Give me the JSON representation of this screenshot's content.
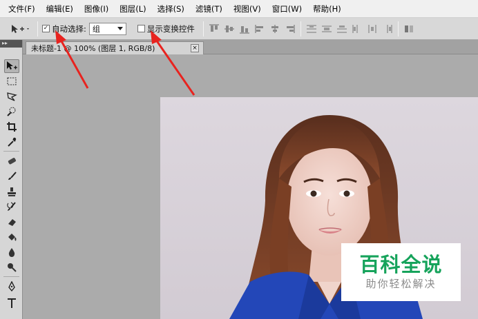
{
  "menubar": {
    "items": [
      {
        "label": "文件(F)"
      },
      {
        "label": "编辑(E)"
      },
      {
        "label": "图像(I)"
      },
      {
        "label": "图层(L)"
      },
      {
        "label": "选择(S)"
      },
      {
        "label": "滤镜(T)"
      },
      {
        "label": "视图(V)"
      },
      {
        "label": "窗口(W)"
      },
      {
        "label": "帮助(H)"
      }
    ]
  },
  "options": {
    "auto_select_label": "自动选择:",
    "auto_select_checked": true,
    "auto_select_value": "组",
    "show_transform_label": "显示变换控件",
    "show_transform_checked": false
  },
  "tools": [
    {
      "name": "move-tool-icon",
      "active": true
    },
    {
      "name": "marquee-tool-icon"
    },
    {
      "name": "lasso-tool-icon"
    },
    {
      "name": "quick-select-tool-icon"
    },
    {
      "name": "crop-tool-icon"
    },
    {
      "name": "eyedropper-tool-icon"
    },
    {
      "name": "spot-healing-tool-icon"
    },
    {
      "name": "brush-tool-icon"
    },
    {
      "name": "clone-stamp-tool-icon"
    },
    {
      "name": "history-brush-tool-icon"
    },
    {
      "name": "eraser-tool-icon"
    },
    {
      "name": "paint-bucket-tool-icon"
    },
    {
      "name": "blur-tool-icon"
    },
    {
      "name": "dodge-tool-icon"
    },
    {
      "name": "pen-tool-icon"
    },
    {
      "name": "type-tool-icon"
    }
  ],
  "document": {
    "tab_title": "未标题-1 @ 100% (图层 1, RGB/8)",
    "close_glyph": "×"
  },
  "watermark": {
    "title": "百科全说",
    "subtitle": "助你轻松解决"
  },
  "colors": {
    "accent_arrow": "#e8231f",
    "watermark_green": "#16a35b"
  }
}
